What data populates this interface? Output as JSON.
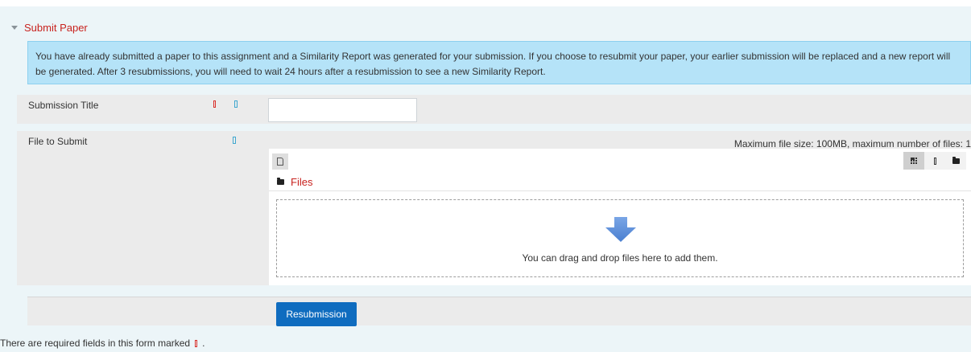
{
  "section": {
    "title": "Submit Paper",
    "caret_icon": "caret-down-icon"
  },
  "alert": {
    "message": "You have already submitted a paper to this assignment and a Similarity Report was generated for your submission. If you choose to resubmit your paper, your earlier submission will be replaced and a new report will be generated. After 3 resubmissions, you will need to wait 24 hours after a resubmission to see a new Similarity Report."
  },
  "form": {
    "title_field": {
      "label": "Submission Title",
      "value": "",
      "required_icon": "required-icon",
      "help_icon": "help-icon"
    },
    "file_field": {
      "label": "File to Submit",
      "help_icon": "help-icon",
      "limits": "Maximum file size: 100MB, maximum number of files: 1",
      "add_file_icon": "add-file-icon",
      "view_modes": [
        {
          "icon": "grid-view-icon",
          "active": true
        },
        {
          "icon": "list-view-icon",
          "active": false
        },
        {
          "icon": "folder-view-icon",
          "active": false
        }
      ],
      "path_label": "Files",
      "path_icon": "folder-icon",
      "drop_icon": "drop-arrow-icon",
      "drop_text": "You can drag and drop files here to add them."
    },
    "submit_label": "Resubmission"
  },
  "footer": {
    "required_note": "There are required fields in this form marked",
    "required_note_end": "."
  },
  "colors": {
    "link_red": "#c8221e",
    "alert_bg": "#b5e3f8",
    "primary_blue": "#0f6cbf",
    "arrow_blue": "#5b8ed8"
  }
}
